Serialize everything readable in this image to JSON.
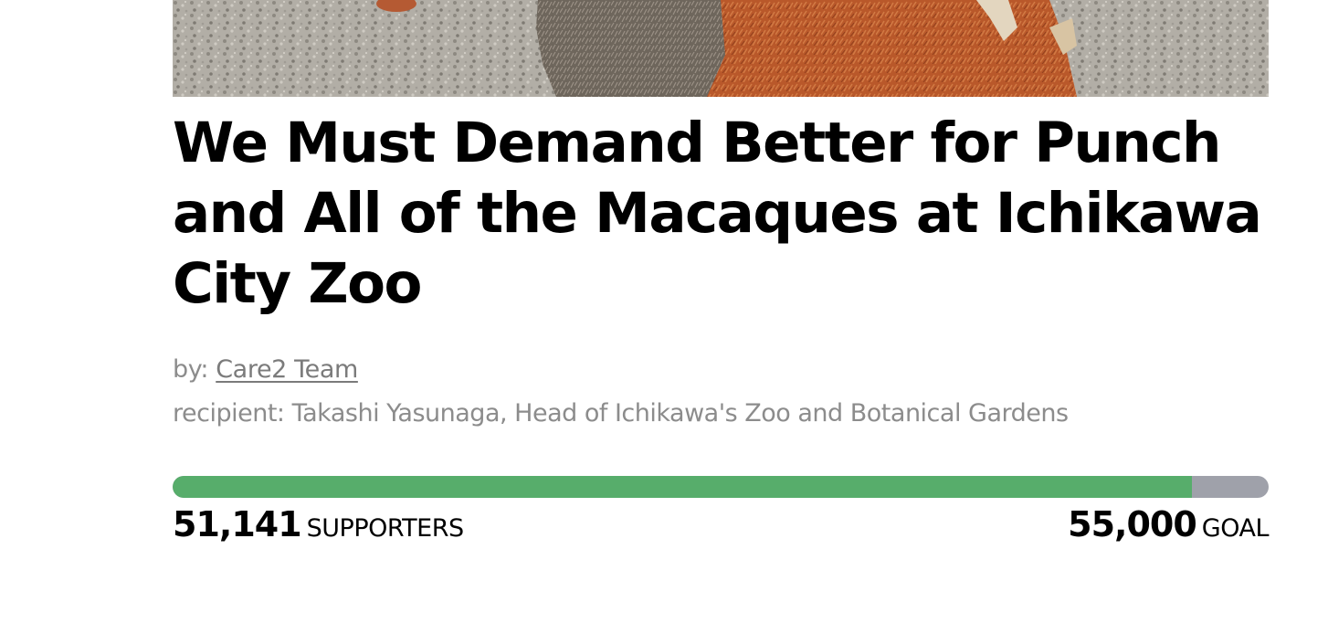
{
  "hero_image": {
    "alt_subject": "macaque with orange plush toy"
  },
  "petition": {
    "title": "We Must Demand Better for Punch and All of the Macaques at Ichikawa City Zoo",
    "by_prefix": "by: ",
    "author": "Care2 Team",
    "recipient_prefix": "recipient: ",
    "recipient": "Takashi Yasunaga, Head of Ichikawa's Zoo and Botanical Gardens"
  },
  "progress": {
    "supporters": "51,141",
    "supporters_label": "SUPPORTERS",
    "goal": "55,000",
    "goal_label": "GOAL",
    "fraction": 0.9298,
    "fill_color": "#57ad6b",
    "track_color": "#9fa1aa"
  }
}
